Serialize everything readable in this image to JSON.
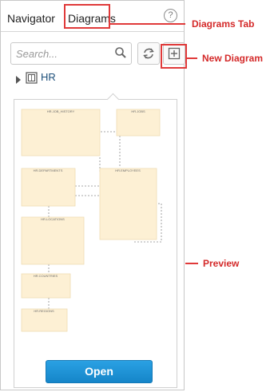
{
  "tabs": {
    "navigator_label": "Navigator",
    "diagrams_label": "Diagrams",
    "help_label": "?"
  },
  "toolbar": {
    "search_placeholder": "Search..."
  },
  "tree": {
    "item_label": "HR"
  },
  "preview": {
    "tables": [
      "HR.JOB_HISTORY",
      "HR.JOBS",
      "HR.DEPARTMENTS",
      "HR.EMPLOYEES",
      "HR.LOCATIONS",
      "HR.COUNTRIES",
      "HR.REGIONS"
    ],
    "open_label": "Open"
  },
  "annotations": {
    "diagrams_tab": "Diagrams Tab",
    "new_diagram": "New Diagram",
    "preview": "Preview"
  },
  "colors": {
    "annotation": "#e03a3a",
    "table_fill": "#fdf0d4",
    "open_button": "#1a8fd4"
  }
}
